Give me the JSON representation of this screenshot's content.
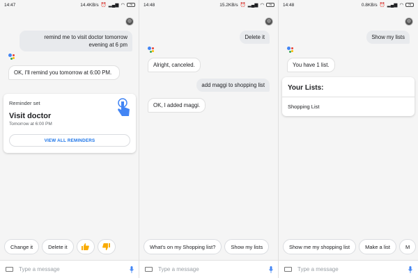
{
  "screens": [
    {
      "status": {
        "time": "14:47",
        "speed": "14.4KB/s",
        "battery": "76"
      },
      "messages": {
        "user1": "remind me to visit doctor tomorrow evening at 6 pm",
        "bot1": "OK, I'll remind you tomorrow at 6:00 PM."
      },
      "reminder": {
        "label": "Reminder set",
        "title": "Visit doctor",
        "subtitle": "Tomorrow at 6:00 PM",
        "button": "VIEW ALL REMINDERS"
      },
      "chips": [
        "Change it",
        "Delete it"
      ],
      "input_placeholder": "Type a message"
    },
    {
      "status": {
        "time": "14:48",
        "speed": "15.2KB/s",
        "battery": "76"
      },
      "messages": {
        "user1": "Delete it",
        "bot1": "Alright, canceled.",
        "user2": "add maggi to shopping list",
        "bot2": "OK, I added maggi."
      },
      "chips": [
        "What's on my Shopping list?",
        "Show my lists"
      ],
      "input_placeholder": "Type a message"
    },
    {
      "status": {
        "time": "14:48",
        "speed": "0.8KB/s",
        "battery": "76"
      },
      "messages": {
        "user1": "Show my lists",
        "bot1": "You have 1 list."
      },
      "lists": {
        "title": "Your Lists:",
        "item": "Shopping List"
      },
      "chips": [
        "Show me my shopping list",
        "Make a list",
        "M"
      ],
      "input_placeholder": "Type a message"
    }
  ],
  "colors": {
    "accent_blue": "#1a73e8",
    "thumb_yellow": "#f9ab00",
    "assistant_blue": "#4285f4",
    "assistant_red": "#ea4335",
    "assistant_yellow": "#fbbc05",
    "assistant_green": "#34a853"
  }
}
